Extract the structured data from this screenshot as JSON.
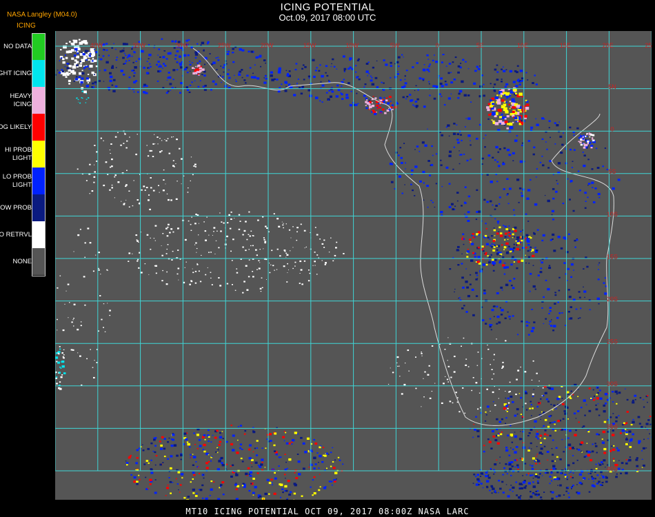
{
  "header": {
    "title": "ICING POTENTIAL",
    "date": "Oct.09, 2017 08:00 UTC",
    "provider": "NASA Langley (M04.0)",
    "legend_title": "ICING"
  },
  "legend": [
    {
      "label": "NO DATA",
      "color": "#22cc22"
    },
    {
      "label": "NIGHT ICING",
      "color": "#00e5ee"
    },
    {
      "label": "HEAVY ICING",
      "color": "#eeb0dd"
    },
    {
      "label": "MOG LIKELY",
      "color": "#ff0000"
    },
    {
      "label": "HI PROB LIGHT",
      "color": "#ffff00"
    },
    {
      "label": "LO PROB LIGHT",
      "color": "#0022ff"
    },
    {
      "label": "LOW PROB",
      "color": "#0a1a80"
    },
    {
      "label": "NO RETRVL",
      "color": "#ffffff"
    },
    {
      "label": "NONE",
      "color": "#555555"
    }
  ],
  "map": {
    "background": "#555555",
    "grid_color": "#3fd6d6",
    "lon_labels": [
      "40W",
      "35W",
      "30W",
      "25W",
      "20W",
      "15W",
      "10W",
      "5W",
      "0",
      "5E",
      "10E",
      "15E",
      "20E",
      "25E",
      "30E"
    ],
    "lat_labels": [
      "5N",
      "0",
      "5S",
      "10S",
      "15S",
      "20S",
      "25S",
      "30S",
      "35S",
      "40S",
      "45S"
    ]
  },
  "footer": {
    "text": "MT10  ICING POTENTIAL    OCT 09, 2017 08:00Z   NASA LARC"
  }
}
